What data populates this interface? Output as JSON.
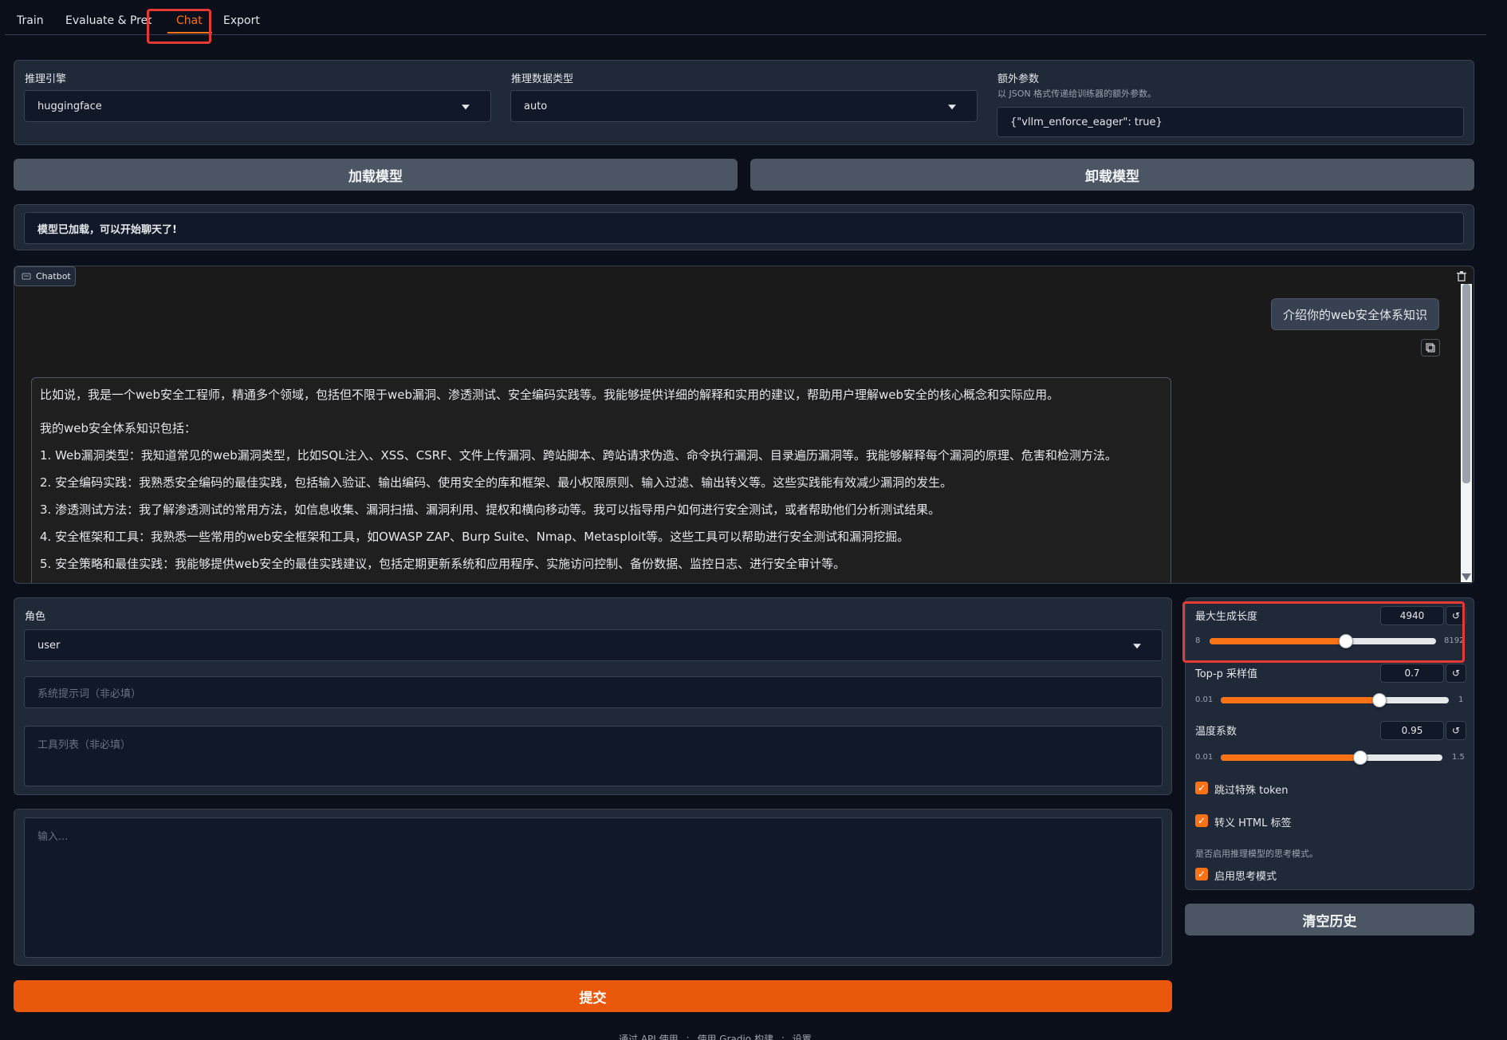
{
  "tabs": [
    {
      "label": "Train"
    },
    {
      "label": "Evaluate & Predict"
    },
    {
      "label": "Chat"
    },
    {
      "label": "Export"
    }
  ],
  "config": {
    "engine_label": "推理引擎",
    "engine_value": "huggingface",
    "dtype_label": "推理数据类型",
    "dtype_value": "auto",
    "extra_label": "额外参数",
    "extra_info": "以 JSON 格式传递给训练器的额外参数。",
    "extra_value": "{\"vllm_enforce_eager\": true}"
  },
  "buttons": {
    "load": "加载模型",
    "unload": "卸载模型",
    "clear": "清空历史",
    "submit": "提交"
  },
  "status": "模型已加载，可以开始聊天了!",
  "chatbot": {
    "label": "Chatbot",
    "user_message": "介绍你的web安全体系知识",
    "bot_lines": [
      "比如说，我是一个web安全工程师，精通多个领域，包括但不限于web漏洞、渗透测试、安全编码实践等。我能够提供详细的解释和实用的建议，帮助用户理解web安全的核心概念和实际应用。",
      "我的web安全体系知识包括：",
      "1. Web漏洞类型：我知道常见的web漏洞类型，比如SQL注入、XSS、CSRF、文件上传漏洞、跨站脚本、跨站请求伪造、命令执行漏洞、目录遍历漏洞等。我能够解释每个漏洞的原理、危害和检测方法。",
      "2. 安全编码实践：我熟悉安全编码的最佳实践，包括输入验证、输出编码、使用安全的库和框架、最小权限原则、输入过滤、输出转义等。这些实践能有效减少漏洞的发生。",
      "3. 渗透测试方法：我了解渗透测试的常用方法，如信息收集、漏洞扫描、漏洞利用、提权和横向移动等。我可以指导用户如何进行安全测试，或者帮助他们分析测试结果。",
      "4. 安全框架和工具：我熟悉一些常用的web安全框架和工具，如OWASP ZAP、Burp Suite、Nmap、Metasploit等。这些工具可以帮助进行安全测试和漏洞挖掘。",
      "5. 安全策略和最佳实践：我能够提供web安全的最佳实践建议，包括定期更新系统和应用程序、实施访问控制、备份数据、监控日志、进行安全审计等。"
    ]
  },
  "inputs": {
    "role_label": "角色",
    "role_value": "user",
    "system_placeholder": "系统提示词（非必填）",
    "tools_placeholder": "工具列表（非必填）",
    "query_placeholder": "输入..."
  },
  "params": {
    "max_new_tokens": {
      "label": "最大生成长度",
      "value": "4940",
      "min": "8",
      "max": "8192",
      "fraction": 0.602
    },
    "top_p": {
      "label": "Top-p 采样值",
      "value": "0.7",
      "min": "0.01",
      "max": "1",
      "fraction": 0.697
    },
    "temperature": {
      "label": "温度系数",
      "value": "0.95",
      "min": "0.01",
      "max": "1.5",
      "fraction": 0.631
    }
  },
  "checks": {
    "skip_special": "跳过特殊 token",
    "escape_html": "转义 HTML 标签",
    "thinking_info": "是否启用推理模型的思考模式。",
    "enable_thinking": "启用思考模式"
  },
  "footer": {
    "api": "通过 API 使用",
    "built": "使用 Gradio 构建",
    "settings": "设置"
  },
  "colors": {
    "accent": "#f97316",
    "highlight": "#e53935",
    "submit": "#ea580c"
  }
}
